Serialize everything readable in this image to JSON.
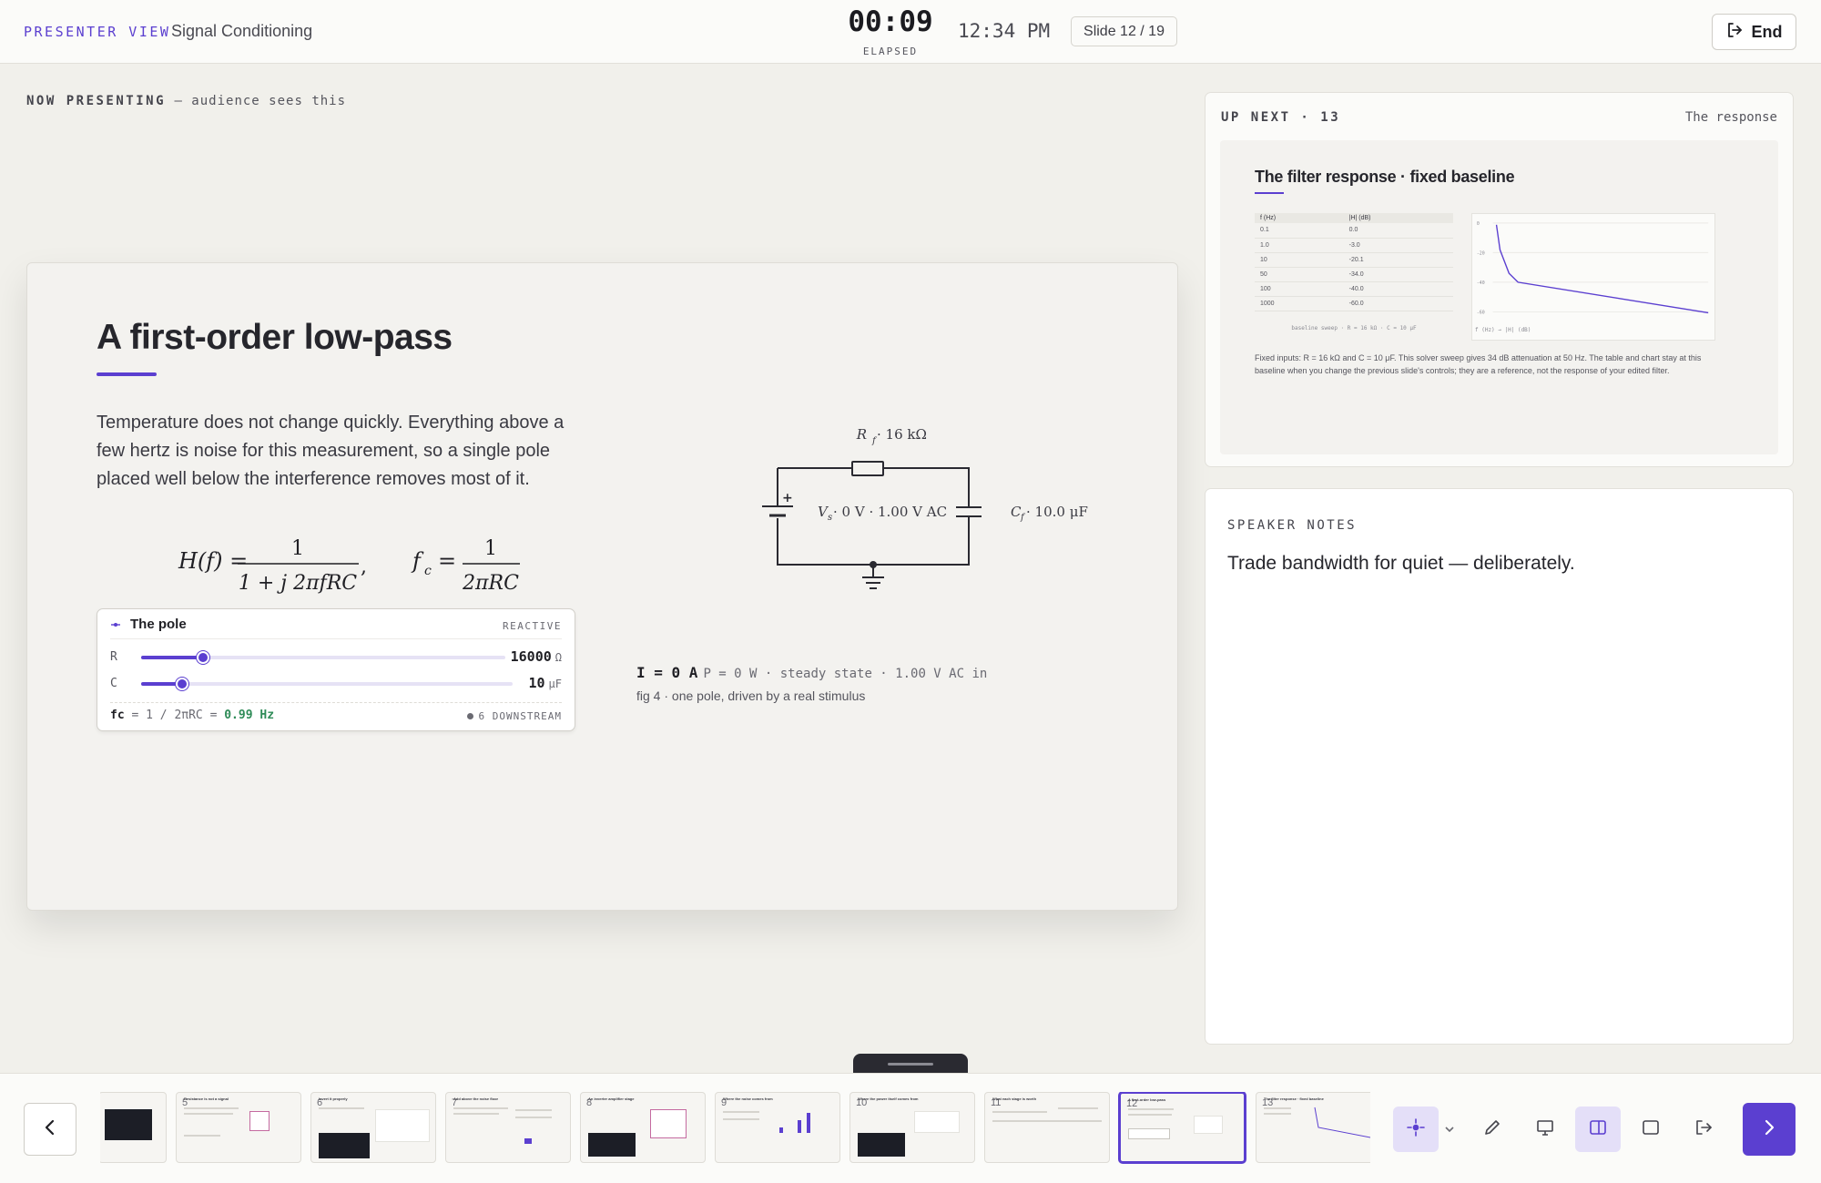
{
  "header": {
    "brand": "PRESENTER VIEW",
    "deck_title": "Signal Conditioning",
    "timer": "00:09",
    "timer_label": "ELAPSED",
    "clock": "12:34 PM",
    "slide_counter": "Slide 12 / 19",
    "end_label": "End"
  },
  "now_presenting": {
    "label": "NOW PRESENTING",
    "sub": "— audience sees this"
  },
  "slide": {
    "title": "A first-order low-pass",
    "body": "Temperature does not change quickly. Everything above a few hertz is noise for this measurement, so a single pole placed well below the interference removes most of it.",
    "formula_h": "H(f) =",
    "formula_h_num": "1",
    "formula_h_den": "1 + j 2πfRC",
    "formula_fc": "f",
    "formula_fc_sub": "c",
    "formula_fc_num": "1",
    "formula_fc_den": "2πRC",
    "pole": {
      "title": "The pole",
      "tag": "REACTIVE",
      "r_label": "R",
      "r_value": "16000",
      "r_unit": "Ω",
      "r_fraction": 0.17,
      "c_label": "C",
      "c_value": "10",
      "c_unit": "μF",
      "c_fraction": 0.11,
      "fc_var": "fc",
      "fc_expr": "= 1 / 2πRC =",
      "fc_value": "0.99 Hz",
      "downstream": "6 DOWNSTREAM"
    },
    "circuit": {
      "rf_label": "R",
      "rf_sub": "f",
      "rf_value": "· 16 kΩ",
      "vs_label": "V",
      "vs_sub": "s",
      "vs_value": "· 0 V · 1.00 V AC",
      "cf_label": "C",
      "cf_sub": "f",
      "cf_value": "· 10.0 μF"
    },
    "current": "I = 0 A",
    "current_detail": "P = 0 W · steady state · 1.00 V AC in",
    "fig_caption": "fig 4 · one pole, driven by a real stimulus"
  },
  "up_next": {
    "label": "UP NEXT · 13",
    "title": "The response",
    "preview_title": "The filter response · fixed baseline",
    "table_headers": [
      "f (Hz)",
      "|H| (dB)"
    ],
    "table_rows": [
      [
        "0.1",
        "0.0"
      ],
      [
        "1.0",
        "-3.0"
      ],
      [
        "10",
        "-20.1"
      ],
      [
        "50",
        "-34.0"
      ],
      [
        "100",
        "-40.0"
      ],
      [
        "1000",
        "-60.0"
      ]
    ],
    "table_caption": "baseline sweep · R = 16 kΩ · C = 10 μF",
    "chart_caption": "f (Hz) → |H| (dB)",
    "note": "Fixed inputs: R = 16 kΩ and C = 10 μF. This solver sweep gives 34 dB attenuation at 50 Hz. The table and chart stay at this baseline when you change the previous slide's controls; they are a reference, not the response of your edited filter."
  },
  "speaker_notes": {
    "label": "SPEAKER NOTES",
    "text": "Trade bandwidth for quiet — deliberately."
  },
  "filmstrip": {
    "thumbs": [
      {
        "num": "",
        "title": ""
      },
      {
        "num": "5",
        "title": "Resistance is not a signal"
      },
      {
        "num": "6",
        "title": "Invert it properly"
      },
      {
        "num": "7",
        "title": "Add above the noise floor"
      },
      {
        "num": "8",
        "title": "An inverter amplifier stage"
      },
      {
        "num": "9",
        "title": "Where the noise comes from"
      },
      {
        "num": "10",
        "title": "Where the power itself comes from"
      },
      {
        "num": "11",
        "title": "What each stage is worth"
      },
      {
        "num": "12",
        "title": "A first-order low-pass"
      },
      {
        "num": "13",
        "title": "The filter response · fixed baseline"
      }
    ],
    "active_index": 8
  },
  "colors": {
    "accent": "#5b3fd0",
    "ok": "#2e8b57"
  }
}
